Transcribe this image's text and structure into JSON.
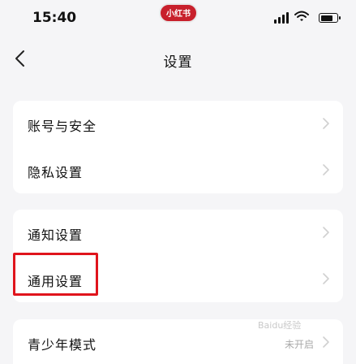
{
  "status_bar": {
    "time": "15:40",
    "app_badge": "小红书",
    "battery_level": 0.8,
    "accent_color": "#c8202c"
  },
  "nav": {
    "back_icon": "chevron-left-icon",
    "title": "设置"
  },
  "sections": [
    {
      "items": [
        {
          "label": "账号与安全"
        },
        {
          "label": "隐私设置"
        }
      ]
    },
    {
      "items": [
        {
          "label": "通知设置"
        },
        {
          "label": "通用设置"
        }
      ]
    },
    {
      "items": [
        {
          "label": "青少年模式",
          "value": "未开启"
        }
      ]
    }
  ],
  "highlight_color": "#e0141c",
  "watermark": "Baidu经验"
}
